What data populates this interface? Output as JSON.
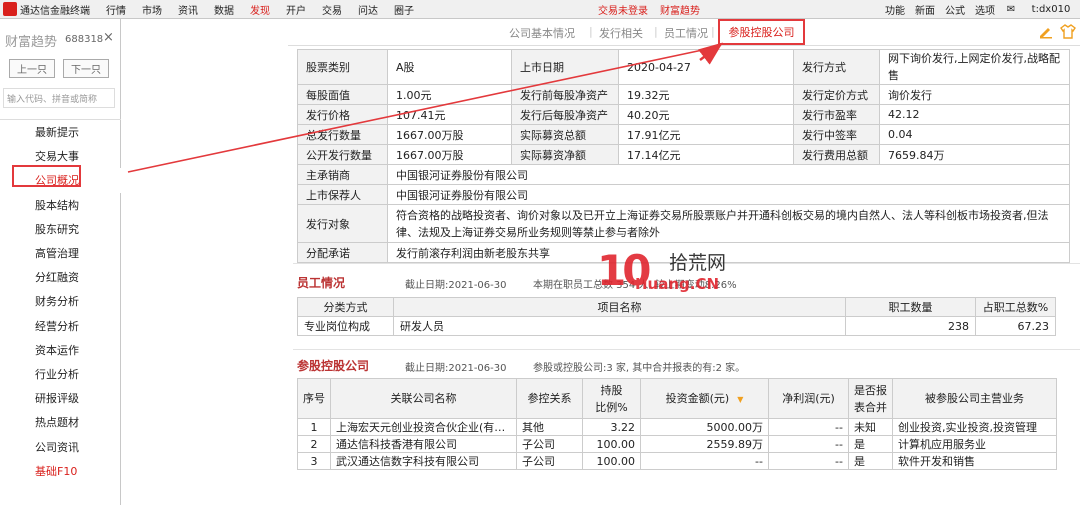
{
  "menubar": {
    "app_name": "通达信金融终端",
    "items": [
      "行情",
      "市场",
      "资讯",
      "数据",
      "发现",
      "开户",
      "交易",
      "问达",
      "圈子"
    ],
    "active_item": "发现",
    "status_1": "交易未登录",
    "status_2": "财富趋势",
    "right_items": [
      "功能",
      "新面",
      "公式",
      "选项"
    ],
    "user": "t:dx010"
  },
  "sidebar": {
    "title": "财富趋势",
    "code": "688318",
    "close": "×",
    "prev_label": "上一只",
    "next_label": "下一只",
    "search_placeholder": "输入代码、拼音或简称",
    "items": [
      "最新提示",
      "交易大事",
      "公司概况",
      "股本结构",
      "股东研究",
      "高管治理",
      "分红融资",
      "财务分析",
      "经营分析",
      "资本运作",
      "行业分析",
      "研报评级",
      "热点题材",
      "公司资讯",
      "基础F10"
    ],
    "selected_item": "公司概况"
  },
  "tabs": {
    "items": [
      "公司基本情况",
      "发行相关",
      "员工情况"
    ],
    "active": "参股控股公司"
  },
  "issue_table": {
    "rows": [
      [
        "股票类别",
        "A股",
        "上市日期",
        "2020-04-27",
        "发行方式",
        "网下询价发行,上网定价发行,战略配售"
      ],
      [
        "每股面值",
        "1.00元",
        "发行前每股净资产",
        "19.32元",
        "发行定价方式",
        "询价发行"
      ],
      [
        "发行价格",
        "107.41元",
        "发行后每股净资产",
        "40.20元",
        "发行市盈率",
        "42.12"
      ],
      [
        "总发行数量",
        "1667.00万股",
        "实际募资总额",
        "17.91亿元",
        "发行中签率",
        "0.04"
      ],
      [
        "公开发行数量",
        "1667.00万股",
        "实际募资净额",
        "17.14亿元",
        "发行费用总额",
        "7659.84万"
      ]
    ],
    "underwriter_label": "主承销商",
    "underwriter": "中国银河证券股份有限公司",
    "sponsor_label": "上市保荐人",
    "sponsor": "中国银河证券股份有限公司",
    "target_label": "发行对象",
    "target": "符合资格的战略投资者、询价对象以及已开立上海证券交易所股票账户并开通科创板交易的境内自然人、法人等科创板市场投资者,但法律、法规及上海证券交易所业务规则等禁止参与者除外",
    "distribution_label": "分配承诺",
    "distribution": "发行前滚存利润由新老股东共享"
  },
  "staff": {
    "title": "员工情况",
    "date": "截止日期:2021-06-30",
    "summary": "本期在职员工总数 354 人, 较上期变动8.26%",
    "headers": [
      "分类方式",
      "项目名称",
      "职工数量",
      "占职工总数%"
    ],
    "rows": [
      [
        "专业岗位构成",
        "研发人员",
        "238",
        "67.23"
      ]
    ]
  },
  "holdings": {
    "title": "参股控股公司",
    "date": "截止日期:2021-06-30",
    "summary": "参股或控股公司:3 家, 其中合并报表的有:2 家。",
    "headers": [
      "序号",
      "关联公司名称",
      "参控关系",
      "持股\n比例%",
      "投资金额(元)",
      "净利润(元)",
      "是否报\n表合并",
      "被参股公司主营业务"
    ],
    "rows": [
      [
        "1",
        "上海宏天元创业投资合伙企业(有…",
        "其他",
        "3.22",
        "5000.00万",
        "--",
        "未知",
        "创业投资,实业投资,投资管理"
      ],
      [
        "2",
        "通达信科技香港有限公司",
        "子公司",
        "100.00",
        "2559.89万",
        "--",
        "是",
        "计算机应用服务业"
      ],
      [
        "3",
        "武汉通达信数字科技有限公司",
        "子公司",
        "100.00",
        "--",
        "--",
        "是",
        "软件开发和销售"
      ]
    ]
  },
  "watermark": {
    "cn": "拾荒网",
    "en": "Huang.CN",
    "num": "10"
  },
  "colors": {
    "accent": "#d9201c",
    "annotation": "#e3393c",
    "section_title": "#b33333"
  }
}
